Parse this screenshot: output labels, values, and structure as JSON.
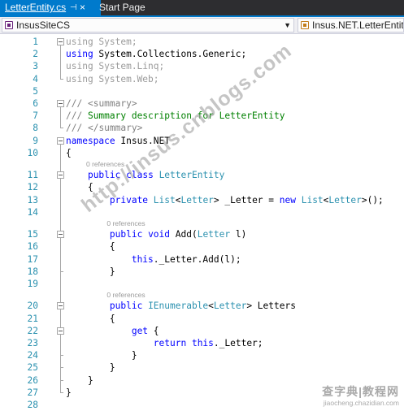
{
  "tabs": {
    "active": {
      "label": "LetterEntity.cs",
      "pin_glyph": "⊣",
      "close_glyph": "×"
    },
    "inactive": {
      "label": "Start Page"
    }
  },
  "nav": {
    "project": "InsusSiteCS",
    "type": "Insus.NET.LetterEntity",
    "dropdown_glyph": "▼"
  },
  "editor": {
    "lines": [
      {
        "n": "1",
        "tokens": [
          {
            "t": "using System;",
            "c": "g"
          }
        ]
      },
      {
        "n": "2",
        "tokens": [
          {
            "t": "using",
            "c": "k"
          },
          {
            "t": " System.Collections.Generic;",
            "c": ""
          }
        ]
      },
      {
        "n": "3",
        "tokens": [
          {
            "t": "using System.Linq;",
            "c": "g"
          }
        ]
      },
      {
        "n": "4",
        "tokens": [
          {
            "t": "using System.Web;",
            "c": "g"
          }
        ]
      },
      {
        "n": "5",
        "tokens": []
      },
      {
        "n": "6",
        "tokens": [
          {
            "t": "///",
            "c": "d"
          },
          {
            "t": " ",
            "c": "c"
          },
          {
            "t": "<summary>",
            "c": "d"
          }
        ]
      },
      {
        "n": "7",
        "tokens": [
          {
            "t": "///",
            "c": "d"
          },
          {
            "t": " Summary description for LetterEntity",
            "c": "c"
          }
        ]
      },
      {
        "n": "8",
        "tokens": [
          {
            "t": "///",
            "c": "d"
          },
          {
            "t": " ",
            "c": "c"
          },
          {
            "t": "</summary>",
            "c": "d"
          }
        ]
      },
      {
        "n": "9",
        "tokens": [
          {
            "t": "namespace",
            "c": "k"
          },
          {
            "t": " Insus.NET",
            "c": ""
          }
        ]
      },
      {
        "n": "10",
        "tokens": [
          {
            "t": "{",
            "c": ""
          }
        ]
      },
      {
        "n": "11",
        "lens": "0 references",
        "tokens": [
          {
            "t": "    ",
            "c": ""
          },
          {
            "t": "public",
            "c": "k"
          },
          {
            "t": " ",
            "c": ""
          },
          {
            "t": "class",
            "c": "k"
          },
          {
            "t": " ",
            "c": ""
          },
          {
            "t": "LetterEntity",
            "c": "t"
          }
        ]
      },
      {
        "n": "12",
        "tokens": [
          {
            "t": "    {",
            "c": ""
          }
        ]
      },
      {
        "n": "13",
        "tokens": [
          {
            "t": "        ",
            "c": ""
          },
          {
            "t": "private",
            "c": "k"
          },
          {
            "t": " ",
            "c": ""
          },
          {
            "t": "List",
            "c": "t"
          },
          {
            "t": "<",
            "c": ""
          },
          {
            "t": "Letter",
            "c": "t"
          },
          {
            "t": "> _Letter = ",
            "c": ""
          },
          {
            "t": "new",
            "c": "k"
          },
          {
            "t": " ",
            "c": ""
          },
          {
            "t": "List",
            "c": "t"
          },
          {
            "t": "<",
            "c": ""
          },
          {
            "t": "Letter",
            "c": "t"
          },
          {
            "t": ">();",
            "c": ""
          }
        ]
      },
      {
        "n": "14",
        "tokens": []
      },
      {
        "n": "15",
        "lens": "0 references",
        "tokens": [
          {
            "t": "        ",
            "c": ""
          },
          {
            "t": "public",
            "c": "k"
          },
          {
            "t": " ",
            "c": ""
          },
          {
            "t": "void",
            "c": "k"
          },
          {
            "t": " Add(",
            "c": ""
          },
          {
            "t": "Letter",
            "c": "t"
          },
          {
            "t": " l)",
            "c": ""
          }
        ]
      },
      {
        "n": "16",
        "tokens": [
          {
            "t": "        {",
            "c": ""
          }
        ]
      },
      {
        "n": "17",
        "tokens": [
          {
            "t": "            ",
            "c": ""
          },
          {
            "t": "this",
            "c": "k"
          },
          {
            "t": "._Letter.Add(l);",
            "c": ""
          }
        ]
      },
      {
        "n": "18",
        "tokens": [
          {
            "t": "        }",
            "c": ""
          }
        ]
      },
      {
        "n": "19",
        "tokens": []
      },
      {
        "n": "20",
        "lens": "0 references",
        "tokens": [
          {
            "t": "        ",
            "c": ""
          },
          {
            "t": "public",
            "c": "k"
          },
          {
            "t": " ",
            "c": ""
          },
          {
            "t": "IEnumerable",
            "c": "t"
          },
          {
            "t": "<",
            "c": ""
          },
          {
            "t": "Letter",
            "c": "t"
          },
          {
            "t": "> Letters",
            "c": ""
          }
        ]
      },
      {
        "n": "21",
        "tokens": [
          {
            "t": "        {",
            "c": ""
          }
        ]
      },
      {
        "n": "22",
        "tokens": [
          {
            "t": "            ",
            "c": ""
          },
          {
            "t": "get",
            "c": "k"
          },
          {
            "t": " {",
            "c": ""
          }
        ]
      },
      {
        "n": "23",
        "tokens": [
          {
            "t": "                ",
            "c": ""
          },
          {
            "t": "return",
            "c": "k"
          },
          {
            "t": " ",
            "c": ""
          },
          {
            "t": "this",
            "c": "k"
          },
          {
            "t": "._Letter;",
            "c": ""
          }
        ]
      },
      {
        "n": "24",
        "tokens": [
          {
            "t": "            }",
            "c": ""
          }
        ]
      },
      {
        "n": "25",
        "tokens": [
          {
            "t": "        }",
            "c": ""
          }
        ]
      },
      {
        "n": "26",
        "tokens": [
          {
            "t": "    }",
            "c": ""
          }
        ]
      },
      {
        "n": "27",
        "tokens": [
          {
            "t": "}",
            "c": ""
          }
        ]
      },
      {
        "n": "28",
        "tokens": []
      }
    ]
  },
  "watermark": {
    "text": "http://insus.cnblogs.com",
    "badge_main": "查字典|教程网",
    "badge_sub": "jiaocheng.chazidian.com"
  },
  "colors": {
    "keyword": "#0000ff",
    "type": "#2b91af",
    "comment": "#008000",
    "doc_tag": "#808080",
    "line_number": "#2b91af",
    "accent": "#007acc"
  }
}
